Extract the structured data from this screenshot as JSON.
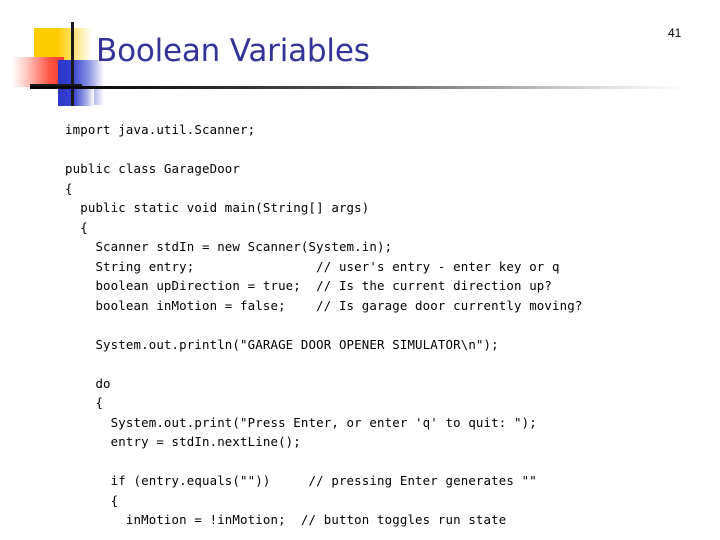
{
  "slide": {
    "page_number": "41",
    "title": "Boolean Variables",
    "title_color": "#333399",
    "background_color": "#ffffff"
  },
  "logo": {
    "yellow_color": "#FFCC00",
    "red_color": "#FF5544",
    "blue_color": "#2A35C8",
    "line_color": "#1a1a1a"
  },
  "code": {
    "language": "java",
    "lines": [
      "import java.util.Scanner;",
      "",
      "public class GarageDoor",
      "{",
      "  public static void main(String[] args)",
      "  {",
      "    Scanner stdIn = new Scanner(System.in);",
      "    String entry;                // user's entry - enter key or q",
      "    boolean upDirection = true;  // Is the current direction up?",
      "    boolean inMotion = false;    // Is garage door currently moving?",
      "",
      "    System.out.println(\"GARAGE DOOR OPENER SIMULATOR\\n\");",
      "",
      "    do",
      "    {",
      "      System.out.print(\"Press Enter, or enter 'q' to quit: \");",
      "      entry = stdIn.nextLine();",
      "",
      "      if (entry.equals(\"\"))     // pressing Enter generates \"\"",
      "      {",
      "        inMotion = !inMotion;  // button toggles run state"
    ]
  }
}
